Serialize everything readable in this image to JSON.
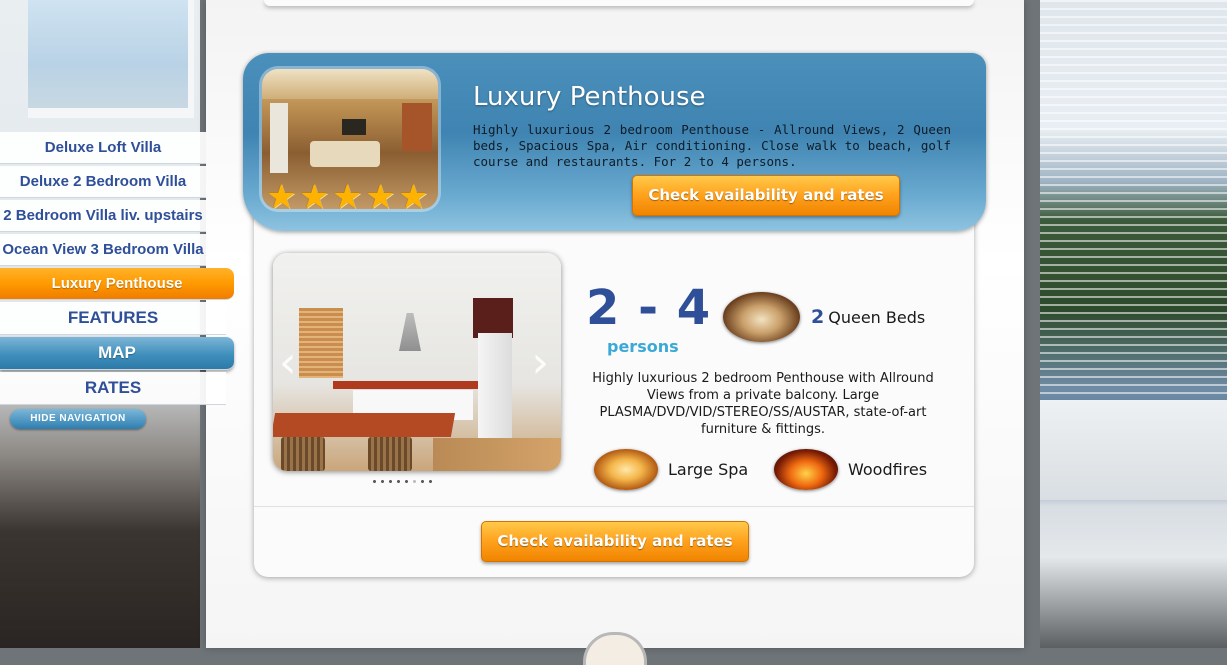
{
  "nav": {
    "items": [
      {
        "label": "Deluxe Loft Villa"
      },
      {
        "label": "Deluxe 2 Bedroom Villa"
      },
      {
        "label": "2 Bedroom Villa liv. upstairs"
      },
      {
        "label": "Ocean View 3 Bedroom Villa"
      },
      {
        "label": "Luxury Penthouse",
        "active": true
      },
      {
        "label": "FEATURES"
      },
      {
        "label": "MAP"
      },
      {
        "label": "RATES"
      }
    ],
    "hide_label": "HIDE NAVIGATION"
  },
  "property": {
    "title": "Luxury Penthouse",
    "summary": "Highly luxurious 2 bedroom Penthouse - Allround Views, 2 Queen beds, Spacious Spa, Air conditioning. Close walk to beach, golf course and restaurants. For 2 to 4 persons.",
    "rating_stars": 5,
    "cta_top": "Check availability and rates",
    "cta_bottom": "Check availability and rates"
  },
  "gallery": {
    "prev_icon": "‹",
    "next_icon": "›",
    "dot_count": 8,
    "active_dot": 5
  },
  "features": {
    "persons_range": "2 - 4",
    "persons_label": "persons",
    "beds_count": "2",
    "beds_label": "Queen Beds",
    "description": "Highly luxurious 2 bedroom Penthouse with Allround Views from a private balcony. Large PLASMA/DVD/VID/STEREO/SS/AUSTAR, state-of-art furniture & fittings.",
    "spa_label": "Large Spa",
    "fire_label": "Woodfires"
  },
  "colors": {
    "accent_orange": "#ff9a00",
    "nav_blue": "#2f4f98",
    "header_blue": "#4b90bb",
    "persons_cyan": "#3aa9d6"
  }
}
